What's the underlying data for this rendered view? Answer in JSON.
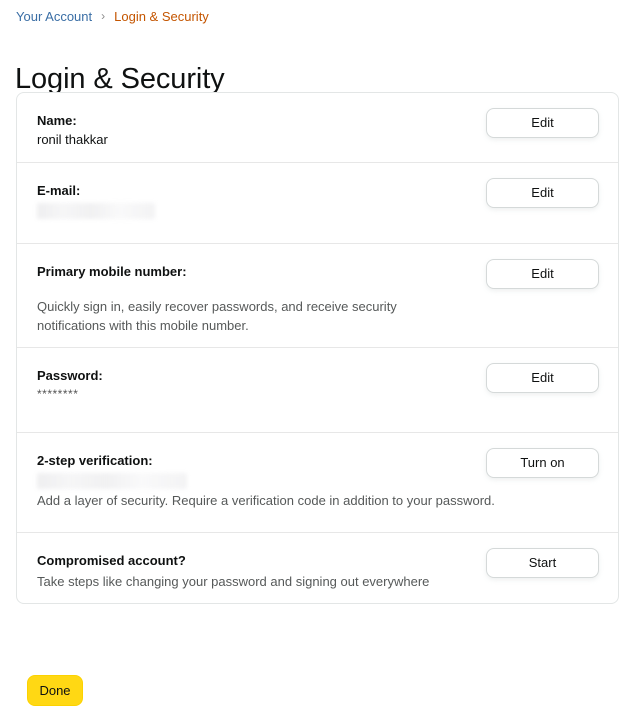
{
  "breadcrumb": {
    "parent_label": "Your Account",
    "separator": "›",
    "current_label": "Login & Security"
  },
  "page_title": "Login & Security",
  "sections": [
    {
      "label": "Name:",
      "value": "ronil thakkar",
      "description": "",
      "button_label": "Edit",
      "redacted": false
    },
    {
      "label": "E-mail:",
      "value": "",
      "description": "",
      "button_label": "Edit",
      "redacted": true
    },
    {
      "label": "Primary mobile number:",
      "value": "",
      "description": "Quickly sign in, easily recover passwords, and receive security notifications with this mobile number.",
      "button_label": "Edit",
      "redacted": false
    },
    {
      "label": "Password:",
      "value": "********",
      "description": "",
      "button_label": "Edit",
      "redacted": false
    },
    {
      "label": "2-step verification:",
      "value": "",
      "description": "Add a layer of security. Require a verification code in addition to your password.",
      "button_label": "Turn on",
      "redacted": true
    },
    {
      "label": "Compromised account?",
      "value": "",
      "description": "Take steps like changing your password and signing out everywhere",
      "button_label": "Start",
      "redacted": false
    }
  ],
  "footer": {
    "done_label": "Done"
  },
  "colors": {
    "link_blue": "#3a6ea5",
    "breadcrumb_orange": "#c45500",
    "done_yellow": "#ffd814",
    "card_border": "#e3e6e6",
    "muted_text": "#565959"
  }
}
